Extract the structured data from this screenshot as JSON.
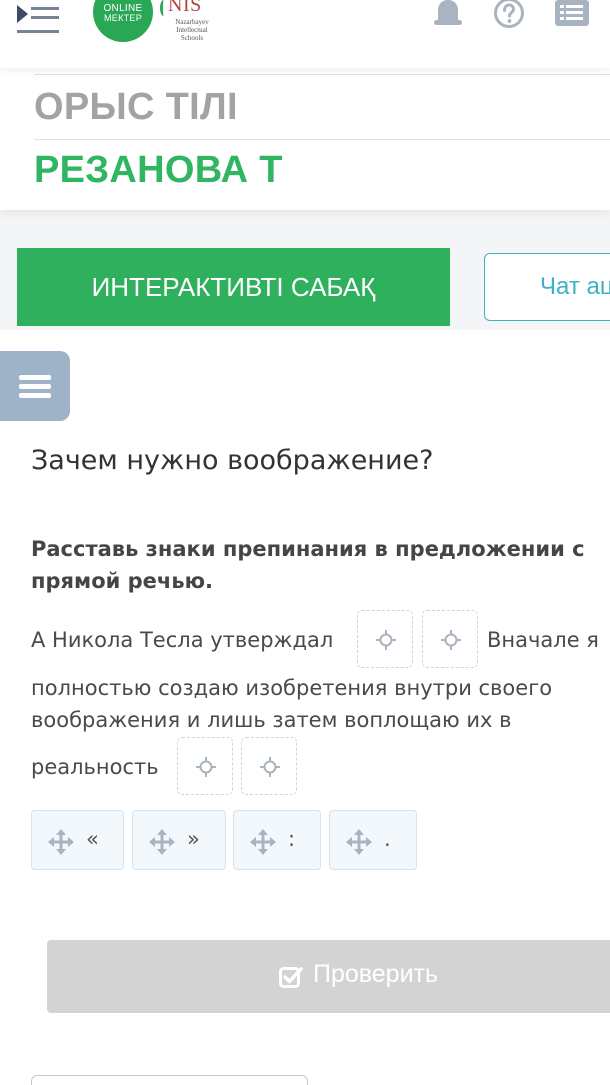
{
  "header": {
    "logo_line1": "ONLINE",
    "logo_line2": "МЕКТЕР",
    "partner_name": "NIS",
    "partner_sub1": "Nazarbayev",
    "partner_sub2": "Intellectual",
    "partner_sub3": "Schools"
  },
  "course": {
    "subject": "ОРЫС ТІЛІ",
    "teacher": "РЕЗАНОВА Т"
  },
  "tabs": {
    "interactive": "ИНТЕРАКТИВТІ САБАҚ",
    "chat": "Чат ац"
  },
  "question": {
    "title": "Зачем нужно воображение?",
    "instruction_line1": "Расставь знаки препинания в предложении с",
    "instruction_line2": "прямой речью.",
    "sentence_part1": "А Никола Тесла утверждал",
    "sentence_part2": "Вначале я",
    "sentence_line2": "полностью создаю изобретения внутри своего",
    "sentence_line3": "воображения и лишь затем воплощаю их в",
    "sentence_line4": "реальность"
  },
  "options": [
    "«",
    "»",
    ":",
    "."
  ],
  "actions": {
    "check": "Проверить"
  },
  "colors": {
    "brand_green": "#2eb05c",
    "subject_gray": "#a3a3a3",
    "teacher_green": "#30b660",
    "chat_accent": "#3eb1c8",
    "sidebar_toggle": "#9fb3c8",
    "check_disabled": "#d3d3d3",
    "top_icon": "#a9b4c1"
  },
  "icons": {
    "menu": "menu-collapse-icon",
    "notifications": "bell-icon",
    "help": "question-circle-icon",
    "list": "list-icon",
    "sidebar": "hamburger-icon",
    "drop": "move-icon",
    "drag": "drag-arrows-icon",
    "check": "checkbox-icon"
  }
}
